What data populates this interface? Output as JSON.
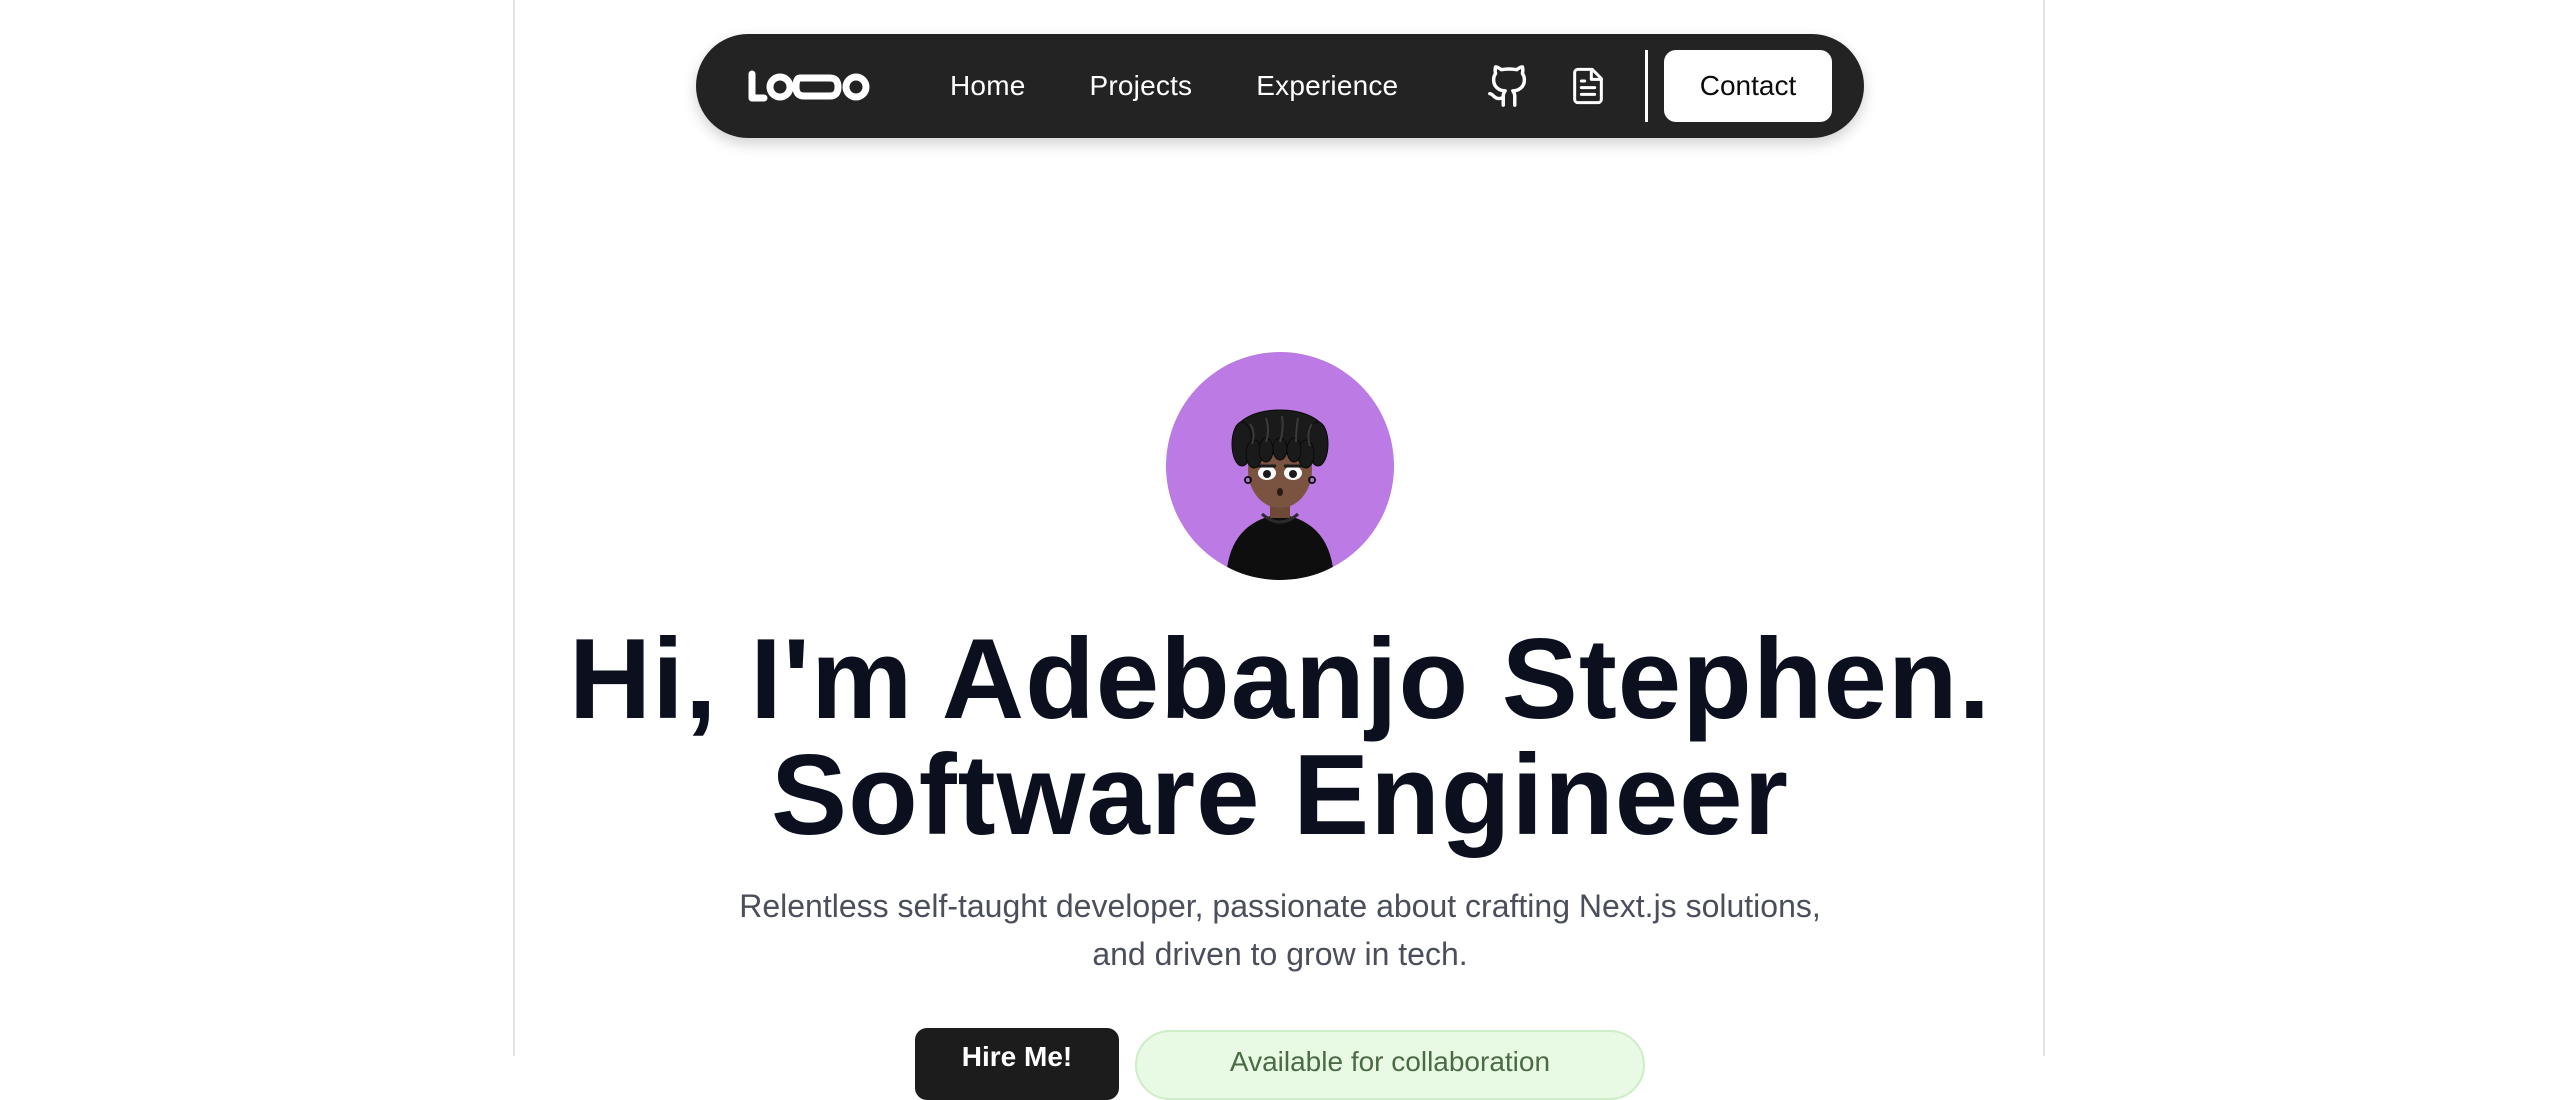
{
  "nav": {
    "logo_alt": "LOQO",
    "links": [
      {
        "label": "Home"
      },
      {
        "label": "Projects"
      },
      {
        "label": "Experience"
      }
    ],
    "icons": [
      {
        "name": "github-icon"
      },
      {
        "name": "resume-document-icon"
      }
    ],
    "contact_label": "Contact"
  },
  "hero": {
    "headline_line1": "Hi, I'm Adebanjo Stephen.",
    "headline_line2": "Software Engineer",
    "subtitle_line1": "Relentless self-taught developer, passionate about crafting Next.js solutions,",
    "subtitle_line2": "and driven to grow in tech.",
    "primary_cta": "Hire Me!",
    "availability": "Available for collaboration"
  },
  "colors": {
    "nav_bg": "#232323",
    "avatar_bg": "#bc7ae4",
    "headline": "#0b0f1e",
    "subtitle": "#4b4f5c",
    "badge_bg": "#e8f9e4"
  }
}
